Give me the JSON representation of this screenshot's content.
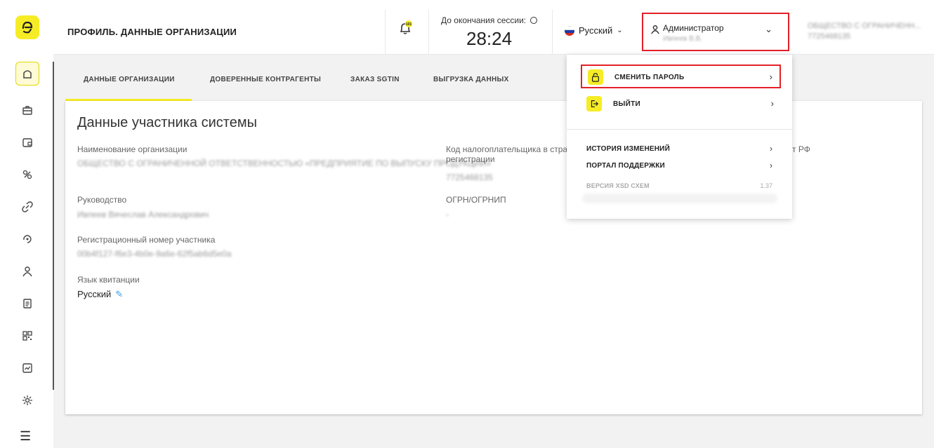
{
  "header": {
    "title": "ПРОФИЛЬ. ДАННЫЕ ОРГАНИЗАЦИИ",
    "notification_badge": "101",
    "session_label": "До окончания сессии:",
    "session_time": "28:24",
    "language": "Русский",
    "user_role": "Администратор",
    "user_name": "Ивпеев В.В.",
    "org_name_line1": "ОБЩЕСТВО С ОГРАНИЧЕНН...",
    "org_name_line2": "7725468135"
  },
  "tabs": [
    {
      "label": "ДАННЫЕ ОРГАНИЗАЦИИ",
      "active": true
    },
    {
      "label": "ДОВЕРЕННЫЕ КОНТРАГЕНТЫ",
      "active": false
    },
    {
      "label": "ЗАКАЗ SGTIN",
      "active": false
    },
    {
      "label": "ВЫГРУЗКА ДАННЫХ",
      "active": false
    }
  ],
  "card": {
    "title": "Данные участника системы",
    "fields": {
      "org_name_label": "Наименование организации",
      "org_name_value": "ОБЩЕСТВО С ОГРАНИЧЕННОЙ ОТВЕТСТВЕННОСТЬЮ «ПРЕДПРИЯТИЕ ПО ВЫПУСКУ ПРОДУКЦИИ»",
      "management_label": "Руководство",
      "management_value": "Ивпеев Вячеслав Александрович",
      "reg_number_label": "Регистрационный номер участника",
      "reg_number_value": "00b4f127-f6e3-4b0e-9a6e-62f5ab6d5e0a",
      "receipt_lang_label": "Язык квитанции",
      "receipt_lang_value": "Русский",
      "taxpayer_label_line1": "Код налогоплательщика в стран",
      "taxpayer_label_line2": "регистрации",
      "taxpayer_value": "7725468135",
      "ogrn_label": "ОГРН/ОГРНИП",
      "ogrn_value": "-",
      "partial_right_label": "т РФ"
    }
  },
  "dropdown": {
    "change_password": "СМЕНИТЬ ПАРОЛЬ",
    "logout": "ВЫЙТИ",
    "history": "ИСТОРИЯ ИЗМЕНЕНИЙ",
    "support": "ПОРТАЛ ПОДДЕРЖКИ",
    "version_label": "ВЕРСИЯ XSD СХЕМ",
    "version_value": "1.37"
  },
  "colors": {
    "accent": "#f6ec26",
    "highlight_border": "#e32028"
  }
}
